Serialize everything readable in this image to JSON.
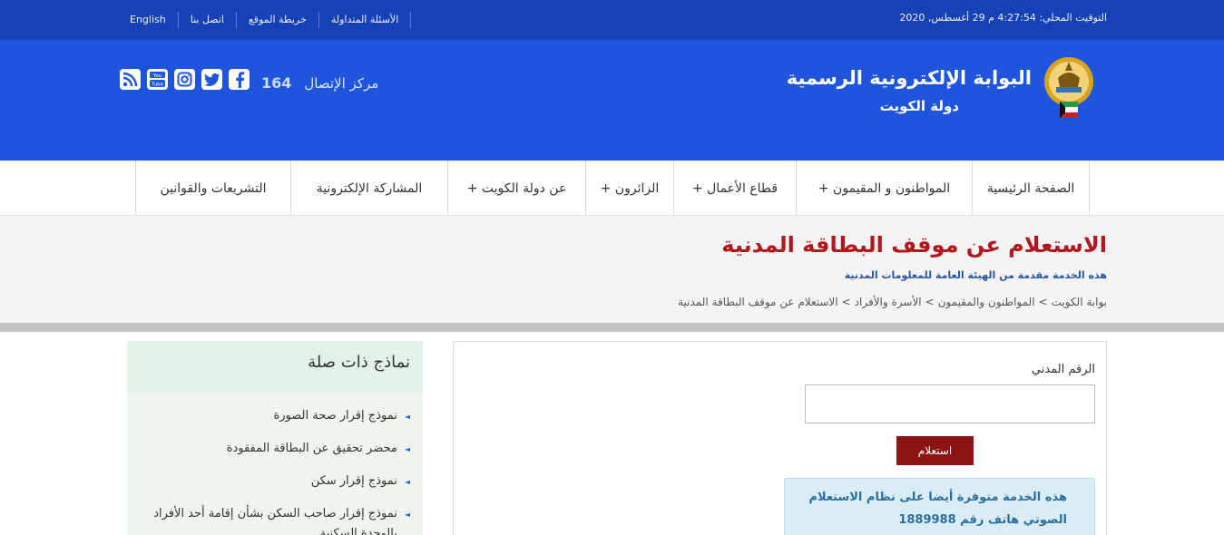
{
  "topbar": {
    "clock": "التوقيت المحلي: 4:27:54 م 29 أغسطس, 2020",
    "links": [
      "English",
      "اتصل بنا",
      "خريطة الموقع",
      "الأسئلة المتداولة"
    ]
  },
  "header": {
    "title": "البوابة الإلكترونية الرسمية",
    "subtitle": "دولة  الكويت",
    "call_center_label": "مركز الإتصال",
    "call_center_number": "164",
    "social_icons": [
      "facebook-icon",
      "twitter-icon",
      "instagram-icon",
      "youtube-icon",
      "rss-icon"
    ]
  },
  "nav": {
    "items": [
      "الصفحة الرئيسية",
      "المواطنون و المقيمون +",
      "قطاع الأعمال +",
      "الزائرون +",
      "عن دولة الكويت +",
      "المشاركة الإلكترونية",
      "التشريعات والقوانين"
    ]
  },
  "page": {
    "title": "الاستعلام عن موقف البطاقة المدنية",
    "subtitle": "هذه الخدمة مقدمة من الهيئة العامة للمعلومات المدنية",
    "breadcrumb": [
      "بوابة الكويت",
      ">",
      "المواطنون والمقيمون",
      ">",
      "الأسرة والأفراد",
      ">",
      "الاستعلام عن موقف البطاقة المدنية"
    ]
  },
  "form": {
    "civil_id_label": "الرقم المدني",
    "civil_id_value": "",
    "submit_label": "استعلام",
    "info_line1": "هذه الخدمة متوفرة أيضا على نظام الاستعلام",
    "info_line2": "الصوتي هاتف رقم 1889988"
  },
  "related": {
    "title": "نماذج ذات صلة",
    "items": [
      "نموذج إقرار صحة الصورة",
      "محضر تحقيق عن البطاقة المفقودة",
      "نموذج إقرار سكن",
      "نموذج إقرار صاحب السكن بشأن إقامة أحد الأفراد بالوحدة السكنية"
    ]
  },
  "colors": {
    "topbar": "#1741b6",
    "header": "#1f55dd",
    "title_red": "#b3171e",
    "button_red": "#8e1414",
    "info_bg": "#d9edf7"
  }
}
